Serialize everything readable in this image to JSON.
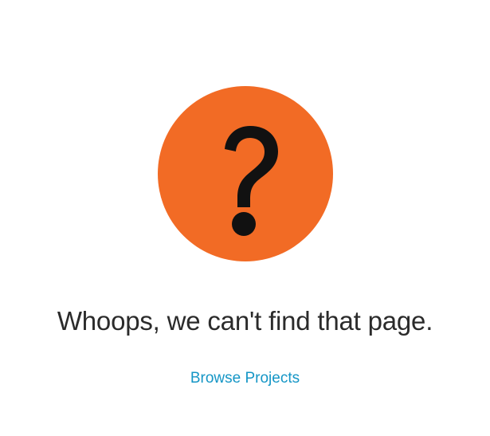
{
  "error_page": {
    "icon": "question-mark-icon",
    "icon_color": "#f26b25",
    "glyph_color": "#111111",
    "heading": "Whoops, we can't find that page.",
    "browse_link_label": "Browse Projects",
    "link_color": "#1596c6"
  }
}
